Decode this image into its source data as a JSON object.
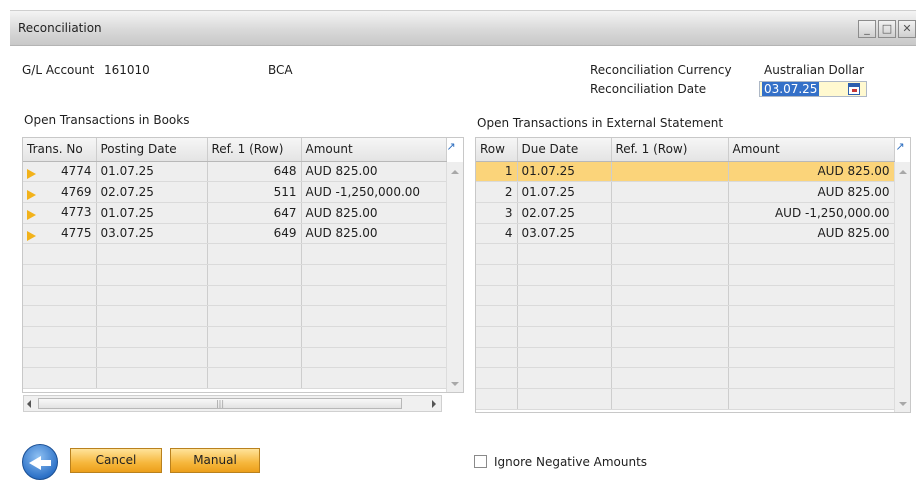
{
  "window": {
    "title": "Reconciliation",
    "controls": {
      "minimize": "_",
      "maximize": "□",
      "close": "✕"
    }
  },
  "header": {
    "gl_account_label": "G/L Account",
    "gl_account_value": "161010",
    "gl_account_name": "BCA",
    "currency_label": "Reconciliation Currency",
    "currency_value": "Australian Dollar",
    "date_label": "Reconciliation Date",
    "date_value": "03.07.25"
  },
  "books": {
    "section_title": "Open Transactions in Books",
    "columns": [
      "Trans. No",
      "Posting Date",
      "Ref. 1 (Row)",
      "Amount"
    ],
    "rows": [
      {
        "trans_no": "4774",
        "posting_date": "01.07.25",
        "ref": "648",
        "amount": "AUD 825.00"
      },
      {
        "trans_no": "4769",
        "posting_date": "02.07.25",
        "ref": "511",
        "amount": "AUD -1,250,000.00"
      },
      {
        "trans_no": "4773",
        "posting_date": "01.07.25",
        "ref": "647",
        "amount": "AUD 825.00"
      },
      {
        "trans_no": "4775",
        "posting_date": "03.07.25",
        "ref": "649",
        "amount": "AUD 825.00"
      }
    ]
  },
  "statement": {
    "section_title": "Open Transactions in External Statement",
    "columns": [
      "Row",
      "Due Date",
      "Ref. 1 (Row)",
      "Amount"
    ],
    "rows": [
      {
        "row": "1",
        "due_date": "01.07.25",
        "ref": "",
        "amount": "AUD 825.00"
      },
      {
        "row": "2",
        "due_date": "01.07.25",
        "ref": "",
        "amount": "AUD 825.00"
      },
      {
        "row": "3",
        "due_date": "02.07.25",
        "ref": "",
        "amount": "AUD -1,250,000.00"
      },
      {
        "row": "4",
        "due_date": "03.07.25",
        "ref": "",
        "amount": "AUD 825.00"
      }
    ]
  },
  "footer": {
    "cancel_label": "Cancel",
    "manual_label": "Manual",
    "ignore_negative_label": "Ignore Negative Amounts"
  },
  "colors": {
    "selected_row": "#fbd47a",
    "button_orange": "#f6b73c",
    "row_arrow": "#f2b21a",
    "date_highlight": "#3470c8"
  }
}
